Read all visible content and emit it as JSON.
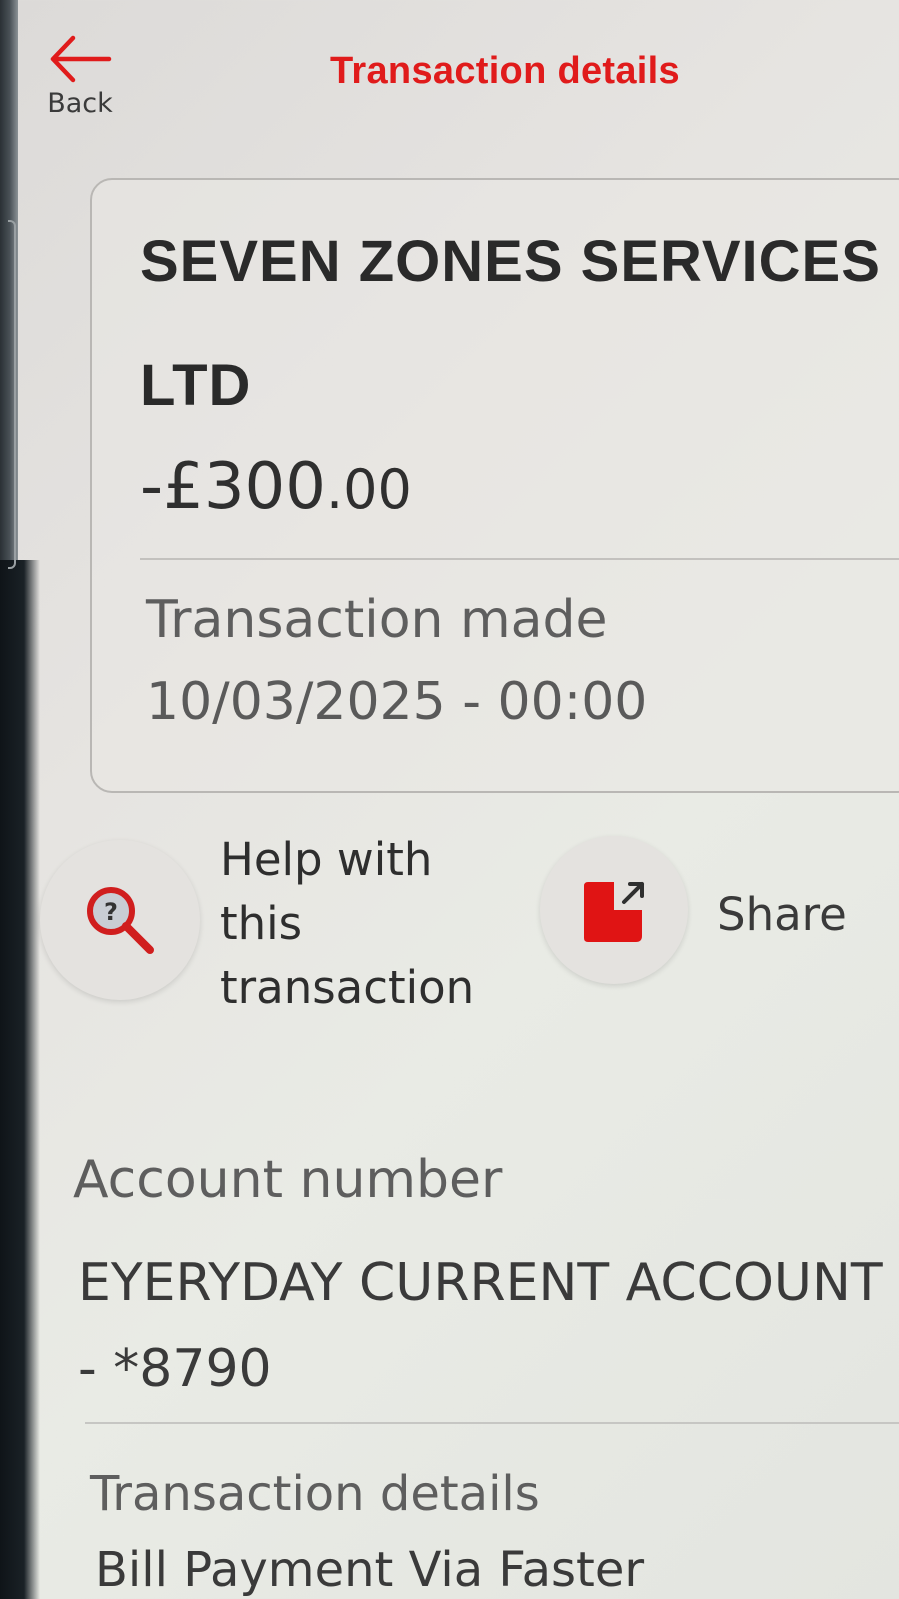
{
  "header": {
    "back_label": "Back",
    "title": "Transaction details"
  },
  "transaction": {
    "merchant_line1": "SEVEN ZONES SERVICES",
    "merchant_line2": "LTD",
    "amount_main": "-£300",
    "amount_pence": ".00",
    "made_label": "Transaction made",
    "made_value": "10/03/2025 - 00:00"
  },
  "actions": {
    "help_label_line1": "Help with",
    "help_label_line2": "this",
    "help_label_line3": "transaction",
    "share_label": "Share"
  },
  "account": {
    "label": "Account number",
    "value_line1": "EYERYDAY CURRENT ACCOUNT",
    "value_line2": "- *8790"
  },
  "details": {
    "label": "Transaction details",
    "value": "Bill Payment Via Faster"
  },
  "colors": {
    "brand_red": "#e01b1b",
    "text_dark": "#2a2a2a",
    "text_muted": "#5e5e5e"
  },
  "icons": {
    "back": "back-arrow-icon",
    "help": "magnifier-question-icon",
    "share": "share-icon"
  }
}
